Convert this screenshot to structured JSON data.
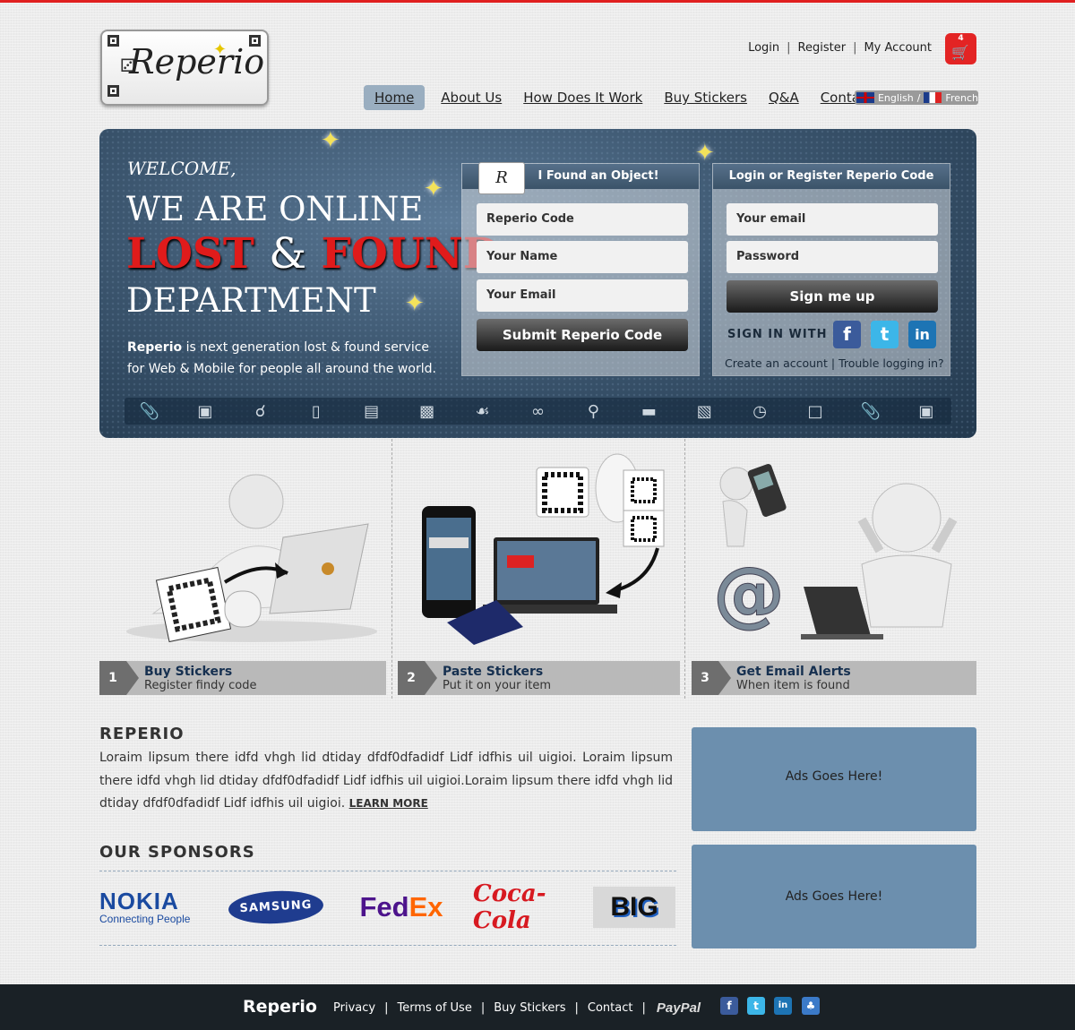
{
  "header": {
    "logo_text": "Reperio",
    "top_links": [
      "Login",
      "Register",
      "My Account"
    ],
    "cart_count": "4",
    "nav": [
      "Home",
      "About Us",
      "How Does It Work",
      "Buy Stickers",
      "Q&A",
      "Contact"
    ],
    "lang": {
      "english": "English",
      "sep": "/",
      "french": "French"
    }
  },
  "hero": {
    "welcome": "WELCOME,",
    "line1": "WE ARE ONLINE",
    "lost": "LOST",
    "amp": "&",
    "found": "FOUND",
    "line3": "DEPARTMENT",
    "desc_brand": "Reperio",
    "desc_rest": " is next generation lost & found service for Web & Mobile for people all around the world.",
    "found_panel": {
      "title": "I Found an Object!",
      "fields": [
        "Reperio Code",
        "Your Name",
        "Your Email"
      ],
      "button": "Submit Reperio Code"
    },
    "login_panel": {
      "title": "Login or Register Reperio Code",
      "fields": [
        "Your email",
        "Password"
      ],
      "button": "Sign me up",
      "sign_in_with": "SIGN IN WITH",
      "create": "Create an account",
      "sep": "|",
      "trouble": "Trouble logging in?"
    }
  },
  "steps": [
    {
      "num": "1",
      "title": "Buy Stickers",
      "subtitle": "Register findy code"
    },
    {
      "num": "2",
      "title": "Paste Stickers",
      "subtitle": "Put it on your item"
    },
    {
      "num": "3",
      "title": "Get Email Alerts",
      "subtitle": "When item is found"
    }
  ],
  "about": {
    "title": "REPERIO",
    "text": "Loraim lipsum there idfd vhgh lid dtiday dfdf0dfadidf  Lidf idfhis uil uigioi. Loraim lipsum there idfd vhgh lid dtiday dfdf0dfadidf  Lidf idfhis uil uigioi.Loraim lipsum there idfd vhgh lid dtiday dfdf0dfadidf  Lidf idfhis uil uigioi.",
    "learn_more": "LEARN MORE"
  },
  "sponsors": {
    "title": "OUR  SPONSORS",
    "nokia": "NOKIA",
    "nokia_tag": "Connecting People",
    "samsung": "SAMSUNG",
    "fedex_fe": "Fed",
    "fedex_ex": "Ex",
    "coke": "Coca-Cola",
    "big": "BIG"
  },
  "ads": [
    "Ads Goes Here!",
    "Ads Goes Here!"
  ],
  "footer": {
    "brand": "Reperio",
    "links": [
      "Privacy",
      "Terms of Use",
      "Buy Stickers",
      "Contact"
    ],
    "paypal": "PayPal"
  },
  "colors": {
    "accent_red": "#e32424",
    "hero_blue": "#3c566f",
    "ad_blue": "#6c8fae"
  }
}
